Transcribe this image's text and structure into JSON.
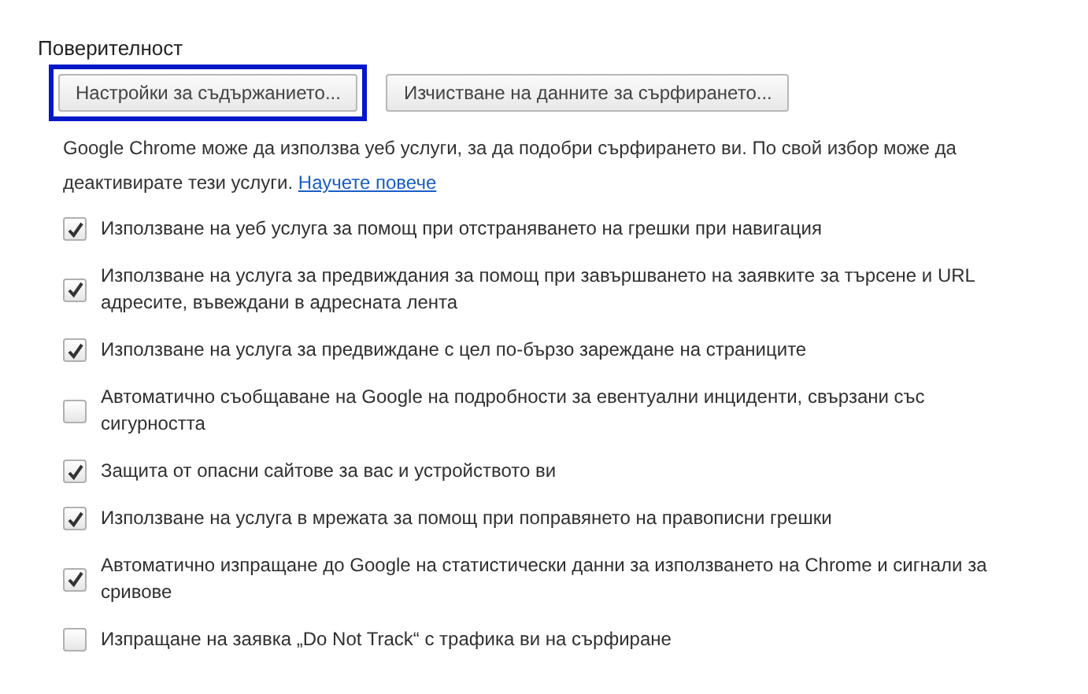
{
  "section_title": "Поверителност",
  "buttons": [
    {
      "label": "Настройки за съдържанието...",
      "highlighted": true
    },
    {
      "label": "Изчистване на данните за сърфирането...",
      "highlighted": false
    }
  ],
  "description": {
    "text": "Google Chrome може да използва уеб услуги, за да подобри сърфирането ви. По свой избор може да деактивирате тези услуги.",
    "link": "Научете повече"
  },
  "options": [
    {
      "label": "Използване на уеб услуга за помощ при отстраняването на грешки при навигация",
      "checked": true
    },
    {
      "label": "Използване на услуга за предвиждания за помощ при завършването на заявките за търсене и URL адресите, въвеждани в адресната лента",
      "checked": true
    },
    {
      "label": "Използване на услуга за предвиждане с цел по-бързо зареждане на страниците",
      "checked": true
    },
    {
      "label": "Автоматично съобщаване на Google на подробности за евентуални инциденти, свързани със сигурността",
      "checked": false
    },
    {
      "label": "Защита от опасни сайтове за вас и устройството ви",
      "checked": true
    },
    {
      "label": "Използване на услуга в мрежата за помощ при поправянето на правописни грешки",
      "checked": true
    },
    {
      "label": "Автоматично изпращане до Google на статистически данни за използването на Chrome и сигнали за сривове",
      "checked": true
    },
    {
      "label": "Изпращане на заявка „Do Not Track“ с трафика ви на сърфиране",
      "checked": false
    }
  ]
}
